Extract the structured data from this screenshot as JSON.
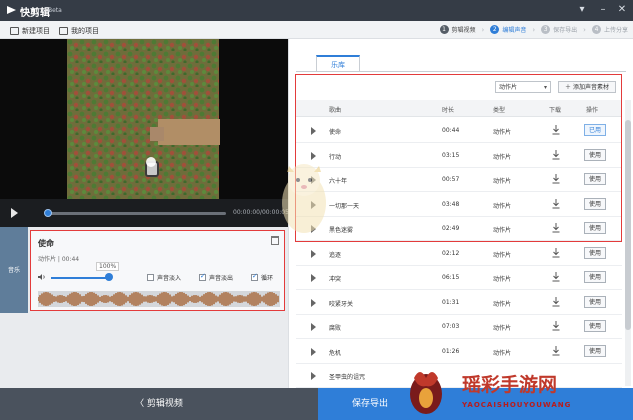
{
  "window": {
    "app_name": "快剪辑",
    "beta_label": "Beta"
  },
  "menu": {
    "new_project": "新建项目",
    "my_projects": "我的项目"
  },
  "steps": [
    {
      "num": "1",
      "label": "剪辑视频",
      "state": "done"
    },
    {
      "num": "2",
      "label": "编辑声音",
      "state": "active"
    },
    {
      "num": "3",
      "label": "保存导出",
      "state": "todo"
    },
    {
      "num": "4",
      "label": "上传分享",
      "state": "todo"
    }
  ],
  "player": {
    "time": "00:00:00/00:00:05"
  },
  "music_panel": {
    "side_tab": "音乐",
    "title": "使命",
    "meta": "动作片  |  00:44",
    "volume_label": "100%",
    "fade_in_label": "声音淡入",
    "fade_in_checked": false,
    "fade_out_label": "声音淡出",
    "fade_out_checked": true,
    "loop_label": "循环",
    "loop_checked": true
  },
  "library": {
    "tab_label": "乐库",
    "genre_select": "动作片",
    "add_button": "添加声音素材",
    "columns": [
      "歌曲",
      "时长",
      "类型",
      "下载",
      "操作"
    ],
    "rows": [
      {
        "name": "使命",
        "duration": "00:44",
        "type": "动作片",
        "action": "已用",
        "used": true
      },
      {
        "name": "行动",
        "duration": "03:15",
        "type": "动作片",
        "action": "使用",
        "used": false
      },
      {
        "name": "六十年",
        "duration": "00:57",
        "type": "动作片",
        "action": "使用",
        "used": false
      },
      {
        "name": "一切那一天",
        "duration": "03:48",
        "type": "动作片",
        "action": "使用",
        "used": false
      },
      {
        "name": "黑色迷雾",
        "duration": "02:49",
        "type": "动作片",
        "action": "使用",
        "used": false
      },
      {
        "name": "追逐",
        "duration": "02:12",
        "type": "动作片",
        "action": "使用",
        "used": false
      },
      {
        "name": "冲突",
        "duration": "06:15",
        "type": "动作片",
        "action": "使用",
        "used": false
      },
      {
        "name": "咬紧牙关",
        "duration": "01:31",
        "type": "动作片",
        "action": "使用",
        "used": false
      },
      {
        "name": "腐败",
        "duration": "07:03",
        "type": "动作片",
        "action": "使用",
        "used": false
      },
      {
        "name": "危机",
        "duration": "01:26",
        "type": "动作片",
        "action": "使用",
        "used": false
      },
      {
        "name": "圣甲虫的诅咒",
        "duration": "",
        "type": "",
        "action": "",
        "used": false
      }
    ]
  },
  "bottom": {
    "back_label": "〈  剪辑视频",
    "export_label": "保存导出"
  },
  "watermark": {
    "text": "瑶彩手游网",
    "sub": "YAOCAISHOUYOUWANG"
  },
  "colors": {
    "accent": "#2f7ed8",
    "highlight": "#e33b3b",
    "titlebar": "#353c46"
  }
}
